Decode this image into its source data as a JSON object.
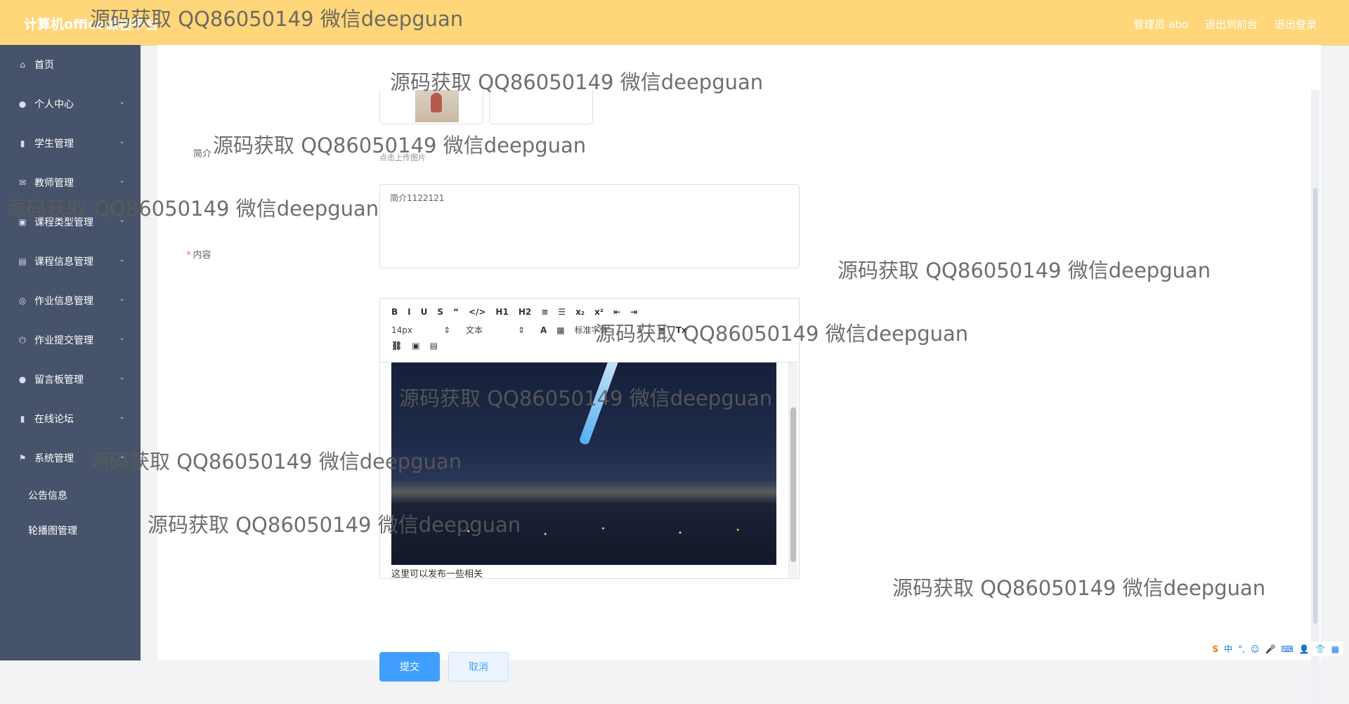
{
  "app": {
    "brand": "计算机office课程平台",
    "top_links": {
      "user": "管理员 abo",
      "to_front": "退出到前台",
      "logout": "退出登录"
    }
  },
  "sidebar": {
    "items": [
      {
        "label": "首页",
        "icon": "home-icon"
      },
      {
        "label": "个人中心",
        "icon": "user-icon"
      },
      {
        "label": "学生管理",
        "icon": "mic-icon"
      },
      {
        "label": "教师管理",
        "icon": "mail-icon"
      },
      {
        "label": "课程类型管理",
        "icon": "briefcase-icon"
      },
      {
        "label": "课程信息管理",
        "icon": "clipboard-icon"
      },
      {
        "label": "作业信息管理",
        "icon": "compass-icon"
      },
      {
        "label": "作业提交管理",
        "icon": "power-icon"
      },
      {
        "label": "留言板管理",
        "icon": "user-icon"
      },
      {
        "label": "在线论坛",
        "icon": "mic-icon"
      },
      {
        "label": "系统管理",
        "icon": "flag-icon"
      }
    ],
    "sub_items": [
      "公告信息",
      "轮播图管理"
    ]
  },
  "form": {
    "upload_hint": "点击上传图片",
    "intro_label": "简介",
    "intro_value": "简介1122121",
    "content_label": "内容",
    "editor": {
      "font_size": "14px",
      "header": "文本",
      "font_family": "标准字体",
      "body_caption": "这里可以发布一些相关"
    },
    "submit_label": "提交",
    "cancel_label": "取消"
  },
  "watermarks": [
    "源码获取 QQ86050149 微信deepguan",
    "源码获取 QQ86050149 微信deepguan",
    "源码获取 QQ86050149 微信deepguan",
    "源码获取 QQ86050149 微信deepguan",
    "源码获取 QQ86050149 微信deepguan",
    "源码获取 QQ86050149 微信deepguan",
    "源码获取 QQ86050149 微信deepguan",
    "源码获取 QQ86050149 微信deepguan",
    "源码获取 QQ86050149 微信deepguan",
    "源码获取 QQ86050149 微信deepguan"
  ],
  "ime": {
    "mode": "中"
  },
  "colors": {
    "topbar": "#ffd77a",
    "sidebar": "#47536a",
    "primary": "#409eff"
  }
}
